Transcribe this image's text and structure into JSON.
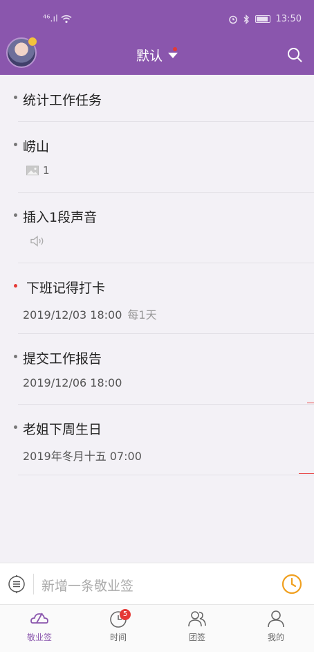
{
  "statusbar": {
    "signal_label": "⁴⁶.ıl",
    "time": "13:50"
  },
  "header": {
    "title": "默认"
  },
  "items": [
    {
      "title": "统计工作任务"
    },
    {
      "title": "崂山",
      "attachment_count": "1"
    },
    {
      "title": "插入1段声音"
    },
    {
      "title": "下班记得打卡",
      "datetime": "2019/12/03 18:00",
      "repeat": "每1天"
    },
    {
      "title": "提交工作报告",
      "datetime": "2019/12/06 18:00"
    },
    {
      "title": "老姐下周生日",
      "datetime": "2019年冬月十五 07:00"
    }
  ],
  "input": {
    "placeholder": "新增一条敬业签"
  },
  "tabs": [
    {
      "label": "敬业签"
    },
    {
      "label": "时间",
      "badge": "5"
    },
    {
      "label": "团签"
    },
    {
      "label": "我的"
    }
  ],
  "colors": {
    "brand": "#8a56ad",
    "accent_orange": "#f0a020",
    "alert_red": "#e53935"
  }
}
